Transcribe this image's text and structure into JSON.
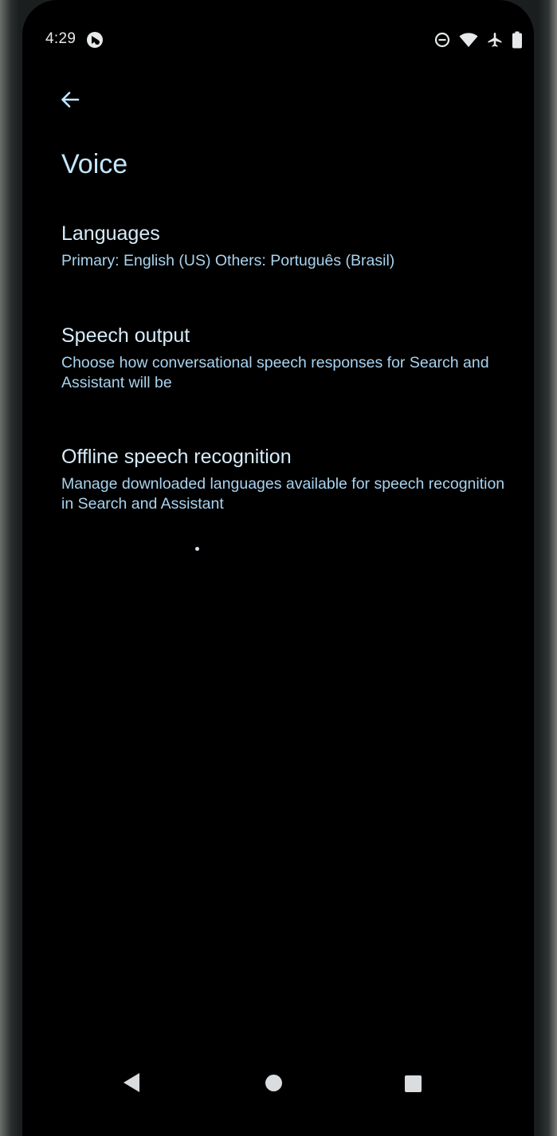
{
  "status_bar": {
    "time": "4:29",
    "icons": [
      "assistant-app-icon",
      "do-not-disturb-icon",
      "wifi-icon",
      "airplane-mode-icon",
      "battery-icon"
    ]
  },
  "header": {
    "back_icon": "arrow-left-icon",
    "title": "Voice"
  },
  "settings": {
    "items": [
      {
        "title": "Languages",
        "summary": "Primary: English (US) Others: Português (Brasil)"
      },
      {
        "title": "Speech output",
        "summary": "Choose how conversational speech responses for Search and Assistant will be"
      },
      {
        "title": "Offline speech recognition",
        "summary": "Manage downloaded languages available for speech recognition in Search and Assistant"
      }
    ]
  },
  "nav_bar": {
    "icons": [
      "nav-back-icon",
      "nav-home-icon",
      "nav-recents-icon"
    ]
  },
  "colors": {
    "background": "#000000",
    "title_text": "#c2e7ff",
    "item_title": "#d7ecfa",
    "item_summary": "#a9d3ef",
    "system_icons": "#e6e8ea"
  }
}
